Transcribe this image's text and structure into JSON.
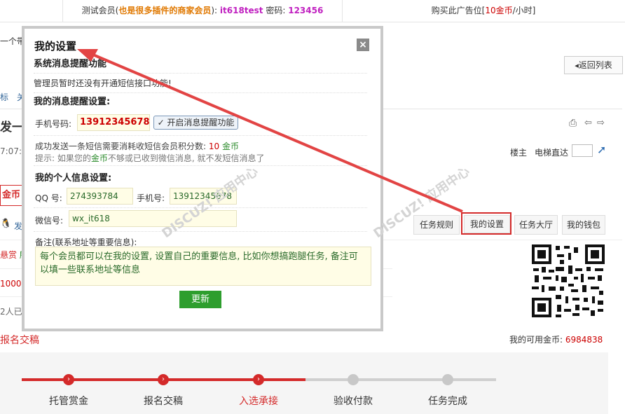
{
  "topbar": {
    "test_label_prefix": "测试会员(",
    "test_label_highlight": "也是很多插件的商家会员",
    "test_label_suffix": "): ",
    "username": "it618test",
    "password_label": " 密码: ",
    "password": "123456",
    "ad_prefix": "购买此广告位[",
    "ad_amount": "10金币",
    "ad_suffix": "/小时]"
  },
  "background": {
    "left_partial_1": "一个带图",
    "back_list_label": "返回列表",
    "tab_partial_1": "标",
    "tab_partial_2": "关",
    "post_title_partial": "发一个",
    "post_time_partial": "7:07:15",
    "floor_label": "楼主",
    "elevator_label": "电梯直达",
    "coin_partial": "金币",
    "issue_partial": "发布",
    "reward_partial": "悬赏",
    "reward_partial_2": "所有",
    "amount_partial": "1000",
    "amount_partial_2": "金",
    "people_partial": "2人已是",
    "signup_partial": "报名交稿",
    "task_rules": "任务规则",
    "my_settings": "我的设置",
    "task_hall": "任务大厅",
    "my_wallet": "我的钱包",
    "available_coins_label": "我的可用金币: ",
    "available_coins": "6984838",
    "steps": [
      {
        "label": "托管赏金",
        "active": true
      },
      {
        "label": "报名交稿",
        "active": true
      },
      {
        "label": "入选承接",
        "active": true
      },
      {
        "label": "验收付款",
        "active": false
      },
      {
        "label": "任务完成",
        "active": false
      }
    ]
  },
  "modal": {
    "title": "我的设置",
    "close_symbol": "×",
    "section1_title": "系统消息提醒功能",
    "section1_text": "管理员暂时还没有开通短信接口功能!",
    "section2_title": "我的消息提醒设置:",
    "phone_label": "手机号码:",
    "phone_value": "13912345678",
    "enable_button": "✓ 开启消息提醒功能",
    "sms_cost_prefix": "成功发送一条短信需要消耗收短信会员积分数: ",
    "sms_cost_value": "10",
    "sms_cost_unit": "金币",
    "hint_prefix": "提示: 如果您的",
    "hint_coin": "金币",
    "hint_suffix": "不够或已收到微信消息, 就不发短信消息了",
    "section3_title": "我的个人信息设置:",
    "qq_label": "QQ 号:",
    "qq_value": "274393784",
    "mobile_label": "手机号:",
    "mobile_value": "13912345678",
    "wechat_label": "微信号:",
    "wechat_value": "wx_it618",
    "note_label": "备注(联系地址等重要信息):",
    "note_value": "每个会员都可以在我的设置, 设置自己的重要信息, 比如你想搞跑腿任务, 备注可以填一些联系地址等信息",
    "update_button": "更新"
  },
  "colors": {
    "accent_red": "#d42a2a",
    "button_green": "#2e9e2e",
    "arrow_red": "#e24444"
  }
}
